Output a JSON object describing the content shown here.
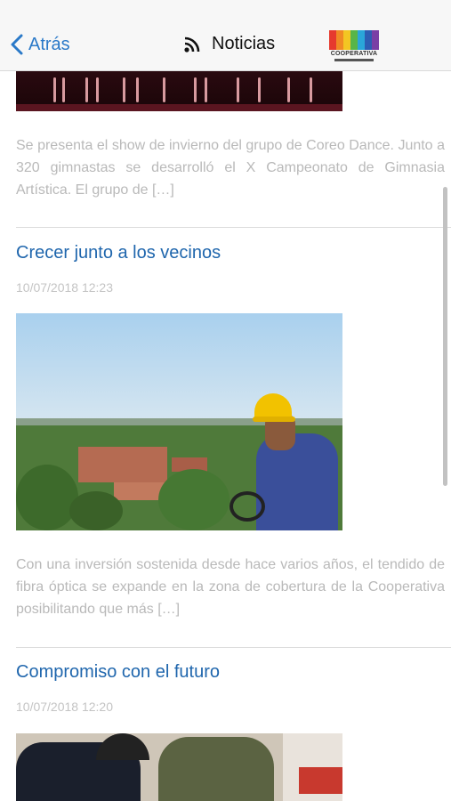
{
  "header": {
    "back_label": "Atrás",
    "title": "Noticias",
    "logo_text": "COOPERATIVA"
  },
  "colors": {
    "accent": "#2a79c8",
    "link_title": "#1f66ad",
    "muted_text": "#b9b9b9",
    "logo_bars": [
      "#e63a2e",
      "#f08a24",
      "#f3c623",
      "#58b548",
      "#2aa6d9",
      "#2d5db3",
      "#7a3fa5"
    ]
  },
  "articles": [
    {
      "excerpt": "Se presenta el show de invierno del grupo de Coreo Dance. Junto a 320 gimnastas se desarrolló el X Campeonato de Gimnasia Artística. El grupo de […]"
    },
    {
      "title": "Crecer junto a los vecinos",
      "date": "10/07/2018 12:23",
      "excerpt": "Con una inversión sostenida desde hace varios años, el tendido de fibra óptica se expande en la zona de cobertura de la Cooperativa posibilitando que más […]"
    },
    {
      "title": "Compromiso con el futuro",
      "date": "10/07/2018 12:20"
    }
  ]
}
